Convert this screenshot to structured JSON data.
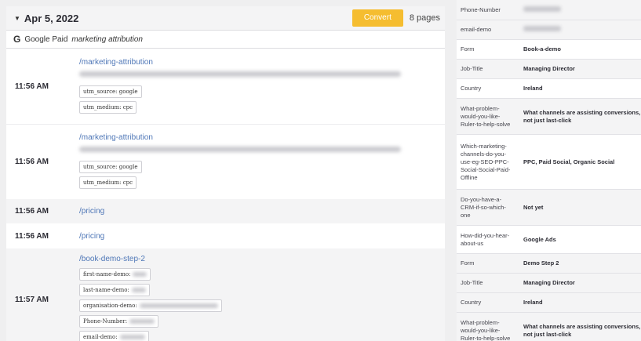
{
  "header": {
    "date": "Apr 5, 2022",
    "convert_label": "Convert",
    "pages_label": "8 pages"
  },
  "source": {
    "icon_letter": "G",
    "name": "Google Paid",
    "campaign": "marketing attribution"
  },
  "events": [
    {
      "time": "11:56 AM",
      "path": "/marketing-attribution",
      "tags": [
        "utm_source: google",
        "utm_medium: cpc"
      ]
    },
    {
      "time": "11:56 AM",
      "path": "/marketing-attribution",
      "tags": [
        "utm_source: google",
        "utm_medium: cpc"
      ]
    },
    {
      "time": "11:56 AM",
      "path": "/pricing"
    },
    {
      "time": "11:56 AM",
      "path": "/pricing"
    },
    {
      "time": "11:57 AM",
      "path": "/book-demo-step-2",
      "fields": [
        "first-name-demo:",
        "last-name-demo:",
        "organisation-demo:",
        "Phone-Number:",
        "email-demo:"
      ]
    }
  ],
  "details": [
    {
      "key": "Phone-Number",
      "value": ""
    },
    {
      "key": "email-demo",
      "value": ""
    },
    {
      "key": "Form",
      "value": "Book-a-demo"
    },
    {
      "key": "Job-Title",
      "value": "Managing Director"
    },
    {
      "key": "Country",
      "value": "Ireland"
    },
    {
      "key": "What-problem-would-you-like-Ruler-to-help-solve",
      "value": "What channels are assisting conversions, not just last-click"
    },
    {
      "key": "Which-marketing-channels-do-you-use-eg-SEO-PPC-Social-Social-Paid-Offline",
      "value": "PPC, Paid Social, Organic Social"
    },
    {
      "key": "Do-you-have-a-CRM-if-so-which-one",
      "value": "Not yet"
    },
    {
      "key": "How-did-you-hear-about-us",
      "value": "Google Ads"
    },
    {
      "key": "Form",
      "value": "Demo Step 2"
    },
    {
      "key": "Job-Title",
      "value": "Managing Director"
    },
    {
      "key": "Country",
      "value": "Ireland"
    },
    {
      "key": "What-problem-would-you-like-Ruler-to-help-solve",
      "value": "What channels are assisting conversions, not just last-click"
    }
  ]
}
